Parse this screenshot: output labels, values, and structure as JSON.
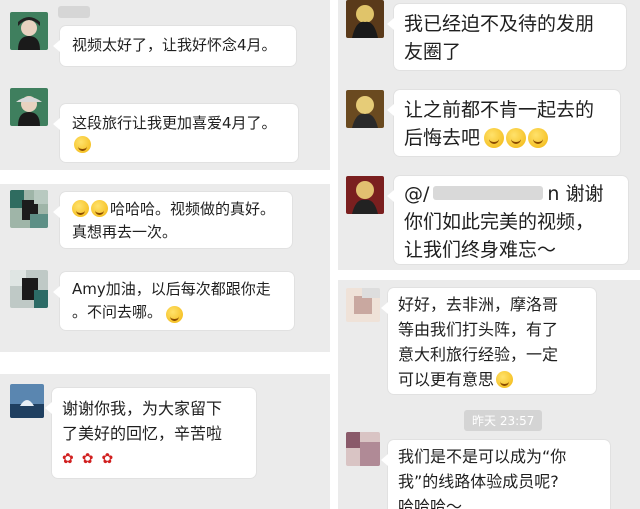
{
  "colors": {
    "panel_bg": "#ebebeb",
    "bubble_bg": "#ffffff",
    "text": "#1f1f1f",
    "timestamp_bg": "#d4d4d4"
  },
  "left": {
    "messages": [
      {
        "text": "视频太好了，让我好怀念4月。"
      },
      {
        "text": "这段旅行让我更加喜爱4月了。"
      },
      {
        "text": "哈哈哈。视频做的真好。\n真想再去一次。"
      },
      {
        "text": "Amy加油，以后每次都跟你走\n。不问去哪。"
      },
      {
        "text": "谢谢你我，为大家留下\n了美好的回忆，辛苦啦"
      }
    ]
  },
  "right": {
    "messages": [
      {
        "text": "我已经迫不及待的发朋\n友圈了"
      },
      {
        "text": "让之前都不肯一起去的\n后悔去吧"
      },
      {
        "text_line1_prefix": "@/",
        "text_line1_suffix": "n 谢谢",
        "text_rest": "你们如此完美的视频，\n让我们终身难忘～"
      },
      {
        "text": "好好，去非洲，摩洛哥\n等由我们打头阵，有了\n意大利旅行经验，一定\n可以更有意思"
      },
      {
        "text": "我们是不是可以成为“你\n我”的线路体验成员呢?\n哈哈哈～"
      }
    ],
    "timestamp": "昨天 23:57"
  },
  "icons": [
    "smile-emoji-icon",
    "grin-emoji-icon",
    "laugh-emoji-icon",
    "rose-icon"
  ]
}
